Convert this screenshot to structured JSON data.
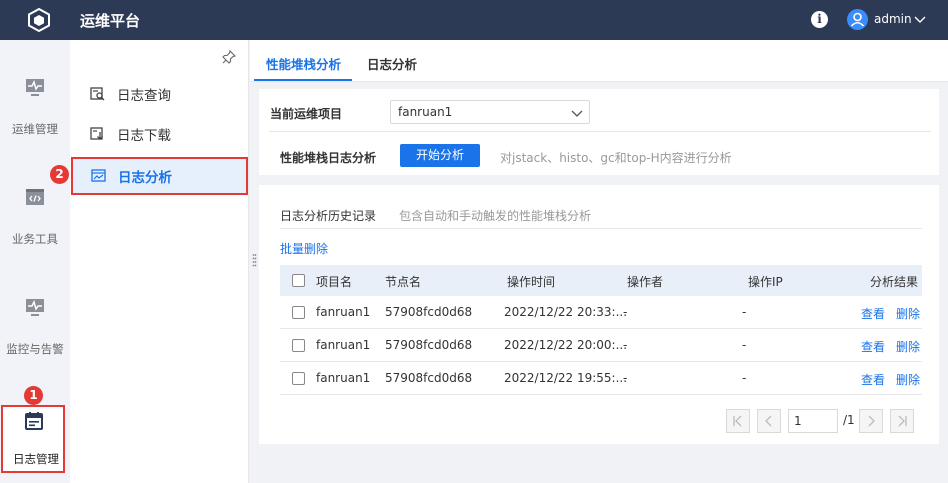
{
  "header": {
    "title": "运维平台",
    "info_glyph": "i",
    "username": "admin"
  },
  "rail": {
    "items": [
      {
        "label": "运维管理",
        "icon": "monitor-pulse-icon"
      },
      {
        "label": "业务工具",
        "icon": "code-window-icon"
      },
      {
        "label": "监控与告警",
        "icon": "monitor-alert-icon"
      },
      {
        "label": "日志管理",
        "icon": "log-calendar-icon",
        "active": true
      }
    ]
  },
  "subnav": {
    "items": [
      {
        "label": "日志查询",
        "icon": "log-search-icon"
      },
      {
        "label": "日志下载",
        "icon": "log-download-icon"
      },
      {
        "label": "日志分析",
        "icon": "log-chart-icon",
        "active": true
      }
    ]
  },
  "badges": {
    "one": "1",
    "two": "2"
  },
  "tabs": [
    {
      "label": "性能堆栈分析",
      "active": true
    },
    {
      "label": "日志分析"
    }
  ],
  "analysis": {
    "project_label": "当前运维项目",
    "project_value": "fanruan1",
    "stack_label": "性能堆栈日志分析",
    "start_button": "开始分析",
    "start_hint": "对jstack、histo、gc和top-H内容进行分析"
  },
  "history": {
    "title": "日志分析历史记录",
    "subtitle": "包含自动和手动触发的性能堆栈分析",
    "bulk_delete": "批量删除",
    "columns": [
      "项目名",
      "节点名",
      "操作时间",
      "操作者",
      "操作IP",
      "分析结果"
    ],
    "rows": [
      {
        "project": "fanruan1",
        "node": "57908fcd0d68",
        "time": "2022/12/22 20:33:...",
        "operator": "-",
        "ip": "-",
        "view": "查看",
        "delete": "删除"
      },
      {
        "project": "fanruan1",
        "node": "57908fcd0d68",
        "time": "2022/12/22 20:00:...",
        "operator": "-",
        "ip": "-",
        "view": "查看",
        "delete": "删除"
      },
      {
        "project": "fanruan1",
        "node": "57908fcd0d68",
        "time": "2022/12/22 19:55:...",
        "operator": "-",
        "ip": "-",
        "view": "查看",
        "delete": "删除"
      }
    ]
  },
  "pager": {
    "current": "1",
    "total": "/1"
  },
  "colors": {
    "header_bg": "#2d3a55",
    "primary": "#1a73e8",
    "highlight": "#e53935"
  }
}
